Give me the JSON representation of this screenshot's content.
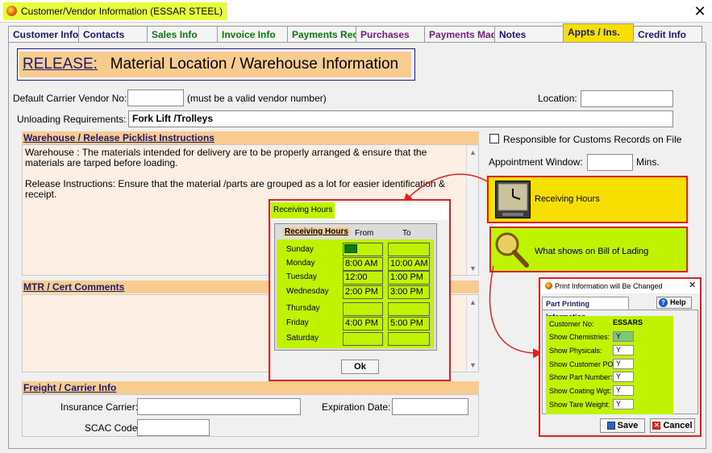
{
  "window": {
    "title": "Customer/Vendor Information  (ESSAR STEEL)",
    "close": "✕"
  },
  "tabs": [
    {
      "label": "Customer Info",
      "color": "#1a1a6e"
    },
    {
      "label": "Contacts",
      "color": "#1a1a6e"
    },
    {
      "label": "Sales Info",
      "color": "#0a7a0a"
    },
    {
      "label": "Invoice Info",
      "color": "#0a7a0a"
    },
    {
      "label": "Payments Rec",
      "color": "#0a7a0a"
    },
    {
      "label": "Purchases",
      "color": "#7a1a7a"
    },
    {
      "label": "Payments Made",
      "color": "#7a1a7a"
    },
    {
      "label": "Notes",
      "color": "#1a1a6e"
    },
    {
      "label": "Appts / Ins.",
      "color": "#1a1a6e"
    },
    {
      "label": "Credit Info",
      "color": "#1a1a6e"
    }
  ],
  "header": {
    "prefix": "RELEASE:",
    "title": "Material Location / Warehouse Information"
  },
  "form": {
    "carrier_label": "Default Carrier Vendor No:",
    "carrier_value": "",
    "carrier_hint": "(must be a valid vendor number)",
    "location_label": "Location:",
    "location_value": "",
    "unloading_label": "Unloading Requirements:",
    "unloading_value": "Fork Lift /Trolleys",
    "customs_label": "Responsible for Customs Records on File",
    "appt_label": "Appointment Window:",
    "appt_value": "",
    "appt_unit": "Mins."
  },
  "warehouse": {
    "heading": "Warehouse / Release Picklist Instructions",
    "line1": "Warehouse : The materials intended for delivery are to be properly arranged & ensure that the materials are tarped before loading.",
    "line2": "Release Instructions: Ensure that the material /parts are grouped as a lot for easier identification & receipt."
  },
  "mtr": {
    "heading": "MTR / Cert Comments",
    "text": ""
  },
  "freight": {
    "heading": "Freight / Carrier Info",
    "insurance_label": "Insurance Carrier:",
    "insurance_value": "",
    "expiration_label": "Expiration Date:",
    "expiration_value": "",
    "scac_label": "SCAC Code:",
    "scac_value": ""
  },
  "callouts": {
    "receiving_hours": "Receiving Hours",
    "bill_of_lading": "What shows on Bill of Lading"
  },
  "receiving_popup": {
    "title": "Receiving Hours",
    "col_title": "Receiving Hours",
    "col_from": "From",
    "col_to": "To",
    "days": [
      {
        "day": "Sunday",
        "from": "",
        "to": ""
      },
      {
        "day": "Monday",
        "from": "8:00 AM",
        "to": "10:00 AM"
      },
      {
        "day": "Tuesday",
        "from": "12:00 PM",
        "to": "1:00 PM"
      },
      {
        "day": "Wednesday",
        "from": "2:00 PM",
        "to": "3:00 PM"
      },
      {
        "day": "Thursday",
        "from": "",
        "to": ""
      },
      {
        "day": "Friday",
        "from": "4:00 PM",
        "to": "5:00 PM"
      },
      {
        "day": "Saturday",
        "from": "",
        "to": ""
      }
    ],
    "ok": "Ok"
  },
  "print_popup": {
    "title": "Print Information will Be Changed",
    "close": "✕",
    "tab": "Part Printing Information",
    "help": "Help",
    "customer_label": "Customer No:",
    "customer_value": "ESSARS",
    "rows": [
      {
        "label": "Show Chemistries:",
        "value": "Y"
      },
      {
        "label": "Show Physicals:",
        "value": "Y"
      },
      {
        "label": "Show Customer PO:",
        "value": "Y"
      },
      {
        "label": "Show Part Number:",
        "value": "Y"
      },
      {
        "label": "Show Coating Wgt:",
        "value": "Y"
      },
      {
        "label": "Show Tare Weight:",
        "value": "Y"
      }
    ],
    "save": "Save",
    "cancel": "Cancel"
  }
}
